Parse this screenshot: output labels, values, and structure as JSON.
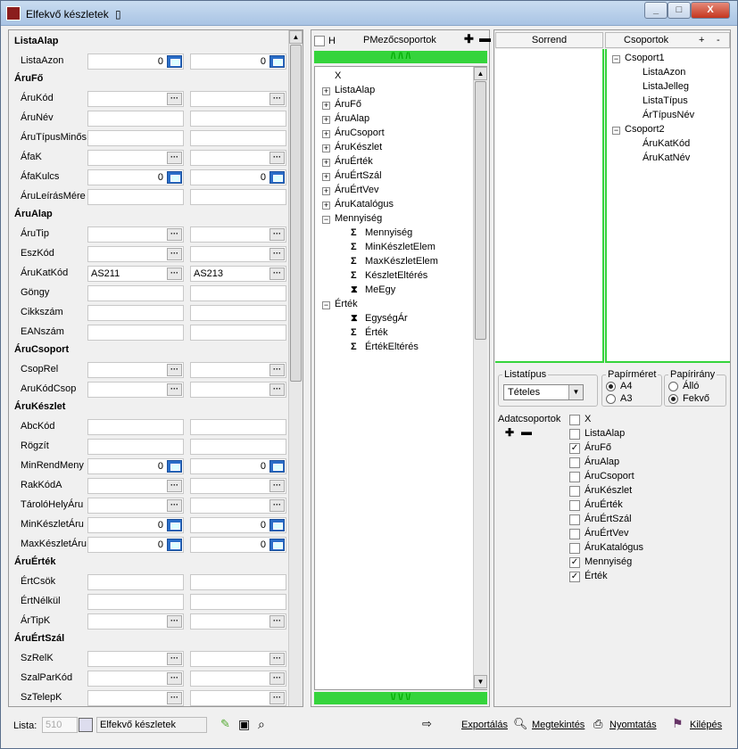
{
  "window": {
    "title": "Elfekvő készletek",
    "title_suffix": "▯"
  },
  "left": {
    "sections": [
      {
        "title": "ListaAlap",
        "rows": [
          {
            "label": "ListaAzon",
            "type": "num",
            "v1": "0",
            "v2": "0"
          }
        ]
      },
      {
        "title": "ÁruFő",
        "rows": [
          {
            "label": "ÁruKód",
            "type": "dots",
            "v1": "",
            "v2": ""
          },
          {
            "label": "ÁruNév",
            "type": "plain",
            "v1": "",
            "v2": ""
          },
          {
            "label": "ÁruTípusMinős",
            "type": "plain",
            "v1": "",
            "v2": ""
          },
          {
            "label": "ÁfaK",
            "type": "dots",
            "v1": "",
            "v2": ""
          },
          {
            "label": "ÁfaKulcs",
            "type": "num",
            "v1": "0",
            "v2": "0"
          },
          {
            "label": "ÁruLeírásMére",
            "type": "plain",
            "v1": "",
            "v2": ""
          }
        ]
      },
      {
        "title": "ÁruAlap",
        "rows": [
          {
            "label": "ÁruTip",
            "type": "dots",
            "v1": "",
            "v2": ""
          },
          {
            "label": "EszKód",
            "type": "dots",
            "v1": "",
            "v2": ""
          },
          {
            "label": "ÁruKatKód",
            "type": "dots",
            "v1": "AS211",
            "v2": "AS213"
          },
          {
            "label": "Göngy",
            "type": "plain",
            "v1": "",
            "v2": ""
          },
          {
            "label": "Cikkszám",
            "type": "plain",
            "v1": "",
            "v2": ""
          },
          {
            "label": "EANszám",
            "type": "plain",
            "v1": "",
            "v2": ""
          }
        ]
      },
      {
        "title": "ÁruCsoport",
        "rows": [
          {
            "label": "CsopRel",
            "type": "dots",
            "v1": "",
            "v2": ""
          },
          {
            "label": "AruKódCsop",
            "type": "dots",
            "v1": "",
            "v2": ""
          }
        ]
      },
      {
        "title": "ÁruKészlet",
        "rows": [
          {
            "label": "AbcKód",
            "type": "plain",
            "v1": "",
            "v2": ""
          },
          {
            "label": "Rögzít",
            "type": "plain",
            "v1": "",
            "v2": ""
          },
          {
            "label": "MinRendMeny",
            "type": "num",
            "v1": "0",
            "v2": "0"
          },
          {
            "label": "RakKódA",
            "type": "dots",
            "v1": "",
            "v2": ""
          },
          {
            "label": "TárolóHelyÁru",
            "type": "dots",
            "v1": "",
            "v2": ""
          },
          {
            "label": "MinKészletÁru",
            "type": "num",
            "v1": "0",
            "v2": "0"
          },
          {
            "label": "MaxKészletÁru",
            "type": "num",
            "v1": "0",
            "v2": "0"
          }
        ]
      },
      {
        "title": "ÁruÉrték",
        "rows": [
          {
            "label": "ÉrtCsök",
            "type": "plain",
            "v1": "",
            "v2": ""
          },
          {
            "label": "ÉrtNélkül",
            "type": "plain",
            "v1": "",
            "v2": ""
          },
          {
            "label": "ÁrTipK",
            "type": "dots",
            "v1": "",
            "v2": ""
          }
        ]
      },
      {
        "title": "ÁruÉrtSzál",
        "rows": [
          {
            "label": "SzRelK",
            "type": "dots",
            "v1": "",
            "v2": ""
          },
          {
            "label": "SzalParKód",
            "type": "dots",
            "v1": "",
            "v2": ""
          },
          {
            "label": "SzTelepK",
            "type": "dots",
            "v1": "",
            "v2": ""
          }
        ]
      }
    ]
  },
  "mid": {
    "checkbox_label": "H",
    "title": "PMezőcsoportok",
    "up": "/\\ /\\ /\\",
    "down": "\\/ \\/ \\/",
    "tree": [
      {
        "text": "X",
        "level": 0,
        "kind": "leaf"
      },
      {
        "text": "ListaAlap",
        "level": 0,
        "kind": "plus"
      },
      {
        "text": "ÁruFő",
        "level": 0,
        "kind": "plus"
      },
      {
        "text": "ÁruAlap",
        "level": 0,
        "kind": "plus"
      },
      {
        "text": "ÁruCsoport",
        "level": 0,
        "kind": "plus"
      },
      {
        "text": "ÁruKészlet",
        "level": 0,
        "kind": "plus"
      },
      {
        "text": "ÁruÉrték",
        "level": 0,
        "kind": "plus"
      },
      {
        "text": "ÁruÉrtSzál",
        "level": 0,
        "kind": "plus"
      },
      {
        "text": "ÁruÉrtVev",
        "level": 0,
        "kind": "plus"
      },
      {
        "text": "ÁruKatalógus",
        "level": 0,
        "kind": "plus"
      },
      {
        "text": "Mennyiség",
        "level": 0,
        "kind": "minus"
      },
      {
        "text": "Mennyiség",
        "level": 1,
        "kind": "sigma"
      },
      {
        "text": "MinKészletElem",
        "level": 1,
        "kind": "sigma"
      },
      {
        "text": "MaxKészletElem",
        "level": 1,
        "kind": "sigma"
      },
      {
        "text": "KészletEltérés",
        "level": 1,
        "kind": "sigma"
      },
      {
        "text": "MeEgy",
        "level": 1,
        "kind": "hourglass"
      },
      {
        "text": "Érték",
        "level": 0,
        "kind": "minus"
      },
      {
        "text": "EgységÁr",
        "level": 1,
        "kind": "hourglass"
      },
      {
        "text": "Érték",
        "level": 1,
        "kind": "sigma"
      },
      {
        "text": "ÉrtékEltérés",
        "level": 1,
        "kind": "sigma"
      }
    ]
  },
  "right": {
    "sorrend": "Sorrend",
    "csoportok": "Csoportok",
    "plus": "+",
    "minus": "-",
    "groups": [
      {
        "text": "Csoport1",
        "level": 0
      },
      {
        "text": "ListaAzon",
        "level": 1
      },
      {
        "text": "ListaJelleg",
        "level": 1
      },
      {
        "text": "ListaTípus",
        "level": 1
      },
      {
        "text": "ÁrTípusNév",
        "level": 1
      },
      {
        "text": "Csoport2",
        "level": 0
      },
      {
        "text": "ÁruKatKód",
        "level": 1
      },
      {
        "text": "ÁruKatNév",
        "level": 1
      }
    ],
    "listatipus_label": "Listatípus",
    "listatipus_value": "Tételes",
    "papirmeret_label": "Papírméret",
    "a4": "A4",
    "a3": "A3",
    "papiriray_label": "Papírirány",
    "allo": "Álló",
    "fekvo": "Fekvő",
    "adatcsoportok_label": "Adatcsoportok",
    "adat": [
      {
        "text": "X",
        "checked": false
      },
      {
        "text": "ListaAlap",
        "checked": false
      },
      {
        "text": "ÁruFő",
        "checked": true
      },
      {
        "text": "ÁruAlap",
        "checked": false
      },
      {
        "text": "ÁruCsoport",
        "checked": false
      },
      {
        "text": "ÁruKészlet",
        "checked": false
      },
      {
        "text": "ÁruÉrték",
        "checked": false
      },
      {
        "text": "ÁruÉrtSzál",
        "checked": false
      },
      {
        "text": "ÁruÉrtVev",
        "checked": false
      },
      {
        "text": "ÁruKatalógus",
        "checked": false
      },
      {
        "text": "Mennyiség",
        "checked": true
      },
      {
        "text": "Érték",
        "checked": true
      }
    ]
  },
  "bottom": {
    "lista_label": "Lista:",
    "lista_num": "510",
    "lista_name": "Elfekvő készletek",
    "export": "Exportálás",
    "preview": "Megtekintés",
    "print": "Nyomtatás",
    "exit": "Kilépés"
  }
}
